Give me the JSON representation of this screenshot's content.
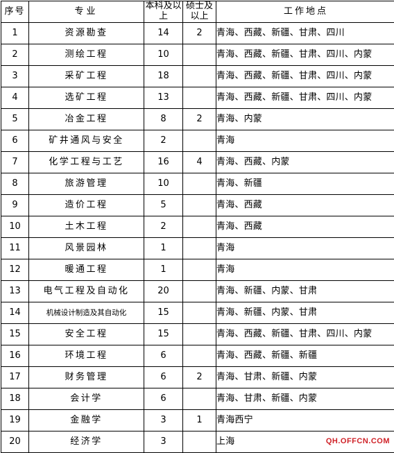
{
  "table": {
    "headers": {
      "index": "序号",
      "major": "专业",
      "bachelor": "本科及以\n上",
      "bachelor_line1": "本科及以",
      "bachelor_line2": "上",
      "master_line1": "硕士及",
      "master_line2": "以上",
      "location": "工作地点"
    },
    "rows": [
      {
        "index": "1",
        "major": "资源勘查",
        "bachelor": "14",
        "master": "2",
        "location": "青海、西藏、新疆、甘肃、四川"
      },
      {
        "index": "2",
        "major": "测绘工程",
        "bachelor": "10",
        "master": "",
        "location": "青海、西藏、新疆、甘肃、四川、内蒙"
      },
      {
        "index": "3",
        "major": "采矿工程",
        "bachelor": "18",
        "master": "",
        "location": "青海、西藏、新疆、甘肃、四川、内蒙"
      },
      {
        "index": "4",
        "major": "选矿工程",
        "bachelor": "13",
        "master": "",
        "location": "青海、西藏、新疆、甘肃、四川、内蒙"
      },
      {
        "index": "5",
        "major": "冶金工程",
        "bachelor": "8",
        "master": "2",
        "location": "青海、内蒙"
      },
      {
        "index": "6",
        "major": "矿井通风与安全",
        "bachelor": "2",
        "master": "",
        "location": "青海"
      },
      {
        "index": "7",
        "major": "化学工程与工艺",
        "bachelor": "16",
        "master": "4",
        "location": "青海、西藏、内蒙"
      },
      {
        "index": "8",
        "major": "旅游管理",
        "bachelor": "10",
        "master": "",
        "location": "青海、新疆"
      },
      {
        "index": "9",
        "major": "造价工程",
        "bachelor": "5",
        "master": "",
        "location": "青海、西藏"
      },
      {
        "index": "10",
        "major": "土木工程",
        "bachelor": "2",
        "master": "",
        "location": "青海、西藏"
      },
      {
        "index": "11",
        "major": "风景园林",
        "bachelor": "1",
        "master": "",
        "location": "青海"
      },
      {
        "index": "12",
        "major": "暖通工程",
        "bachelor": "1",
        "master": "",
        "location": "青海"
      },
      {
        "index": "13",
        "major": "电气工程及自动化",
        "bachelor": "20",
        "master": "",
        "location": "青海、新疆、内蒙、甘肃"
      },
      {
        "index": "14",
        "major": "机械设计制造及其自动化",
        "bachelor": "15",
        "master": "",
        "location": "青海、新疆、内蒙、甘肃",
        "major_small": true
      },
      {
        "index": "15",
        "major": "安全工程",
        "bachelor": "15",
        "master": "",
        "location": "青海、西藏、新疆、甘肃、四川、内蒙"
      },
      {
        "index": "16",
        "major": "环境工程",
        "bachelor": "6",
        "master": "",
        "location": "青海、西藏、新疆、新疆"
      },
      {
        "index": "17",
        "major": "财务管理",
        "bachelor": "6",
        "master": "2",
        "location": "青海、甘肃、新疆、内蒙"
      },
      {
        "index": "18",
        "major": "会计学",
        "bachelor": "6",
        "master": "",
        "location": "青海、甘肃、新疆、内蒙"
      },
      {
        "index": "19",
        "major": "金融学",
        "bachelor": "3",
        "master": "1",
        "location": "青海西宁"
      },
      {
        "index": "20",
        "major": "经济学",
        "bachelor": "3",
        "master": "",
        "location": "上海"
      }
    ]
  },
  "watermark": {
    "text": "QH.OFFCN.COM",
    "color": "#cf2127"
  }
}
